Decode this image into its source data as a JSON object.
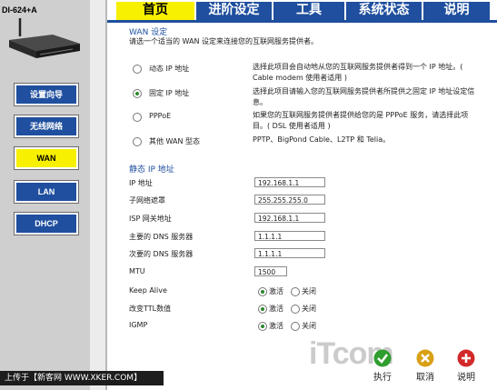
{
  "brand": {
    "model": "DI-624+A"
  },
  "sidebar": {
    "items": [
      {
        "label": "设置向导"
      },
      {
        "label": "无线网络"
      },
      {
        "label": "WAN"
      },
      {
        "label": "LAN"
      },
      {
        "label": "DHCP"
      }
    ],
    "active": "WAN"
  },
  "tabs": [
    {
      "label": "首页"
    },
    {
      "label": "进阶设定"
    },
    {
      "label": "工具"
    },
    {
      "label": "系统状态"
    },
    {
      "label": "说明"
    }
  ],
  "wan": {
    "title": "WAN 设定",
    "subtitle": "请选一个适当的 WAN 设定来连接您的互联网服务提供者。",
    "options": [
      {
        "label": "动态 IP 地址",
        "desc": "选择此项目会自动地从您的互联网服务提供者得到一个 IP 地址。( Cable modem 使用者适用 )",
        "selected": false
      },
      {
        "label": "固定 IP 地址",
        "desc": "选择此项目请输入您的互联网服务提供者所提供之固定 IP 地址设定信息。",
        "selected": true
      },
      {
        "label": "PPPoE",
        "desc": "如果您的互联网服务提供者提供给您的是 PPPoE 服务，请选择此项目。( DSL 使用者适用 )",
        "selected": false
      },
      {
        "label": "其他 WAN 型态",
        "desc": "PPTP、BigPond Cable、L2TP 和 Telia。",
        "selected": false
      }
    ]
  },
  "static_ip": {
    "title": "静态 IP 地址",
    "fields": [
      {
        "label": "IP 地址",
        "value": "192.168.1.1"
      },
      {
        "label": "子网络遮罩",
        "value": "255.255.255.0"
      },
      {
        "label": "ISP 网关地址",
        "value": "192.168.1.1"
      },
      {
        "label": "主要的 DNS 服务器",
        "value": "1.1.1.1"
      },
      {
        "label": "次要的 DNS 服务器",
        "value": "1.1.1.1"
      },
      {
        "label": "MTU",
        "value": "1500"
      }
    ],
    "toggles": [
      {
        "label": "Keep Alive",
        "on_label": "激活",
        "off_label": "关闭",
        "value": "on"
      },
      {
        "label": "改变TTL数值",
        "on_label": "激活",
        "off_label": "关闭",
        "value": "on"
      },
      {
        "label": "IGMP",
        "on_label": "激活",
        "off_label": "关闭",
        "value": "on"
      }
    ]
  },
  "actions": {
    "apply": "执行",
    "cancel": "取消",
    "help": "说明"
  },
  "footer": {
    "uploader": "上传于【新客网 WWW.XKER.COM】"
  },
  "watermark": "iTcom",
  "colors": {
    "nav_blue": "#1f4f9e",
    "active_yellow": "#f7f000"
  }
}
